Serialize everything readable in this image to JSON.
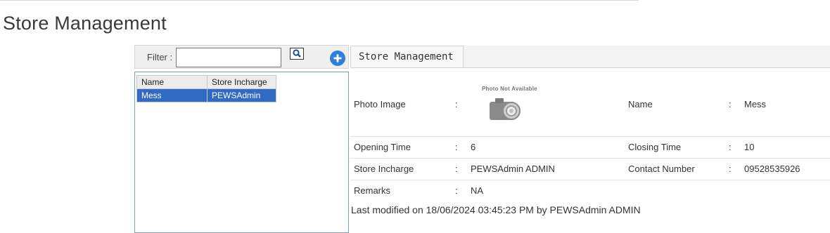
{
  "page": {
    "title": "Store Management"
  },
  "filter": {
    "label": "Filter :",
    "value": "",
    "placeholder": ""
  },
  "icons": {
    "search": "search-icon",
    "add": "plus-circle-icon",
    "photo": "camera-icon"
  },
  "colors": {
    "selected_row": "#316ac5",
    "add_button": "#2f7ed8"
  },
  "list": {
    "columns": [
      "Name",
      "Store Incharge"
    ],
    "rows": [
      {
        "name": "Mess",
        "incharge": "PEWSAdmin",
        "selected": true
      }
    ]
  },
  "tab": {
    "label": "Store Management"
  },
  "detail": {
    "photo_label": "Photo Image",
    "photo_placeholder": "Photo Not Available",
    "name_label": "Name",
    "name_value": "Mess",
    "opening_label": "Opening Time",
    "opening_value": "6",
    "closing_label": "Closing Time",
    "closing_value": "10",
    "incharge_label": "Store Incharge",
    "incharge_value": "PEWSAdmin ADMIN",
    "contact_label": "Contact Number",
    "contact_value": "09528535926",
    "remarks_label": "Remarks",
    "remarks_value": "NA",
    "separator": ":"
  },
  "footer": {
    "last_modified": "Last modified on 18/06/2024 03:45:23 PM by PEWSAdmin ADMIN"
  }
}
